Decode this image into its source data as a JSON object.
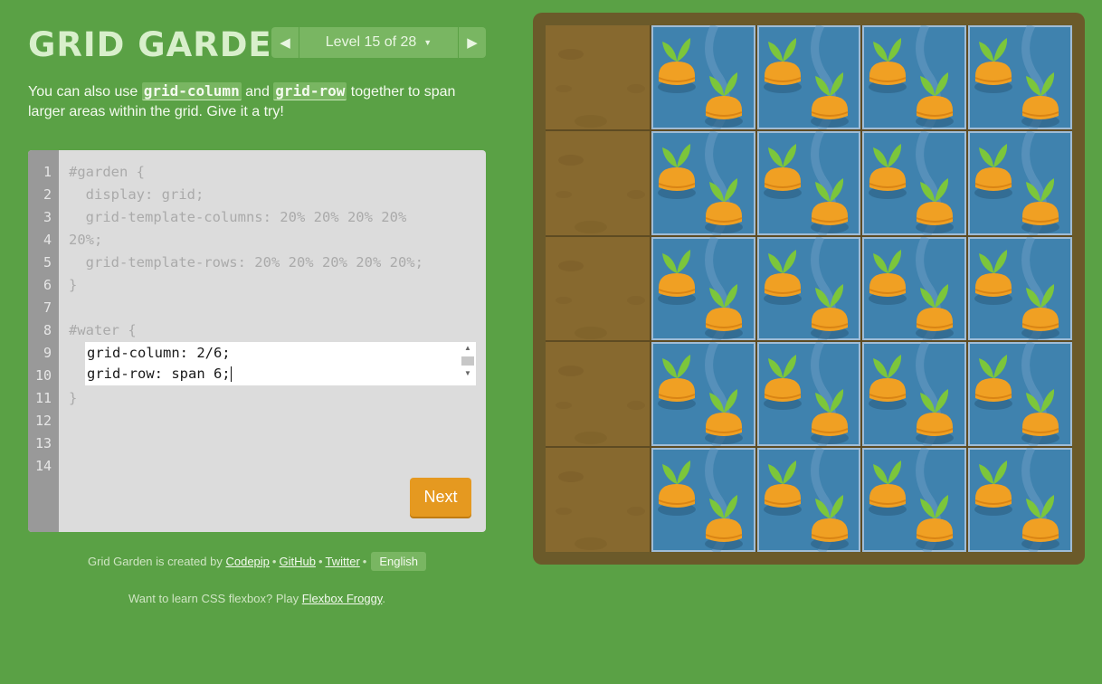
{
  "header": {
    "title": "GRID GARDEN",
    "level_text": "Level 15 of 28",
    "prev_icon": "◀",
    "next_icon": "▶",
    "caret_icon": "▼"
  },
  "instructions": {
    "part1": "You can also use ",
    "code1": "grid-column",
    "part2": " and ",
    "code2": "grid-row",
    "part3": " together to span larger areas within the grid. Give it a try!"
  },
  "editor": {
    "line_numbers": [
      "1",
      "2",
      "3",
      "4",
      "5",
      "6",
      "7",
      "8",
      "9",
      "10",
      "11",
      "12",
      "13",
      "14"
    ],
    "lines": [
      "#garden {",
      "  display: grid;",
      "  grid-template-columns: 20% 20% 20% 20%",
      "20%;",
      "  grid-template-rows: 20% 20% 20% 20% 20%;",
      "}",
      "",
      "#water {",
      "",
      "",
      "}"
    ],
    "answer_line1": "grid-column: 2/6;",
    "answer_line2": "grid-row: span 6;",
    "next_label": "Next"
  },
  "footer": {
    "created_by": "Grid Garden is created by ",
    "codepip": "Codepip",
    "github": "GitHub",
    "twitter": "Twitter",
    "language": "English",
    "flexbox_text": "Want to learn CSS flexbox? Play ",
    "flexbox_link": "Flexbox Froggy"
  },
  "colors": {
    "background": "#5aa145",
    "soil": "#87692f",
    "water": "#3f82ae",
    "carrot": "#f0a023",
    "sprout": "#7cc63b",
    "next_button": "#e59920"
  }
}
